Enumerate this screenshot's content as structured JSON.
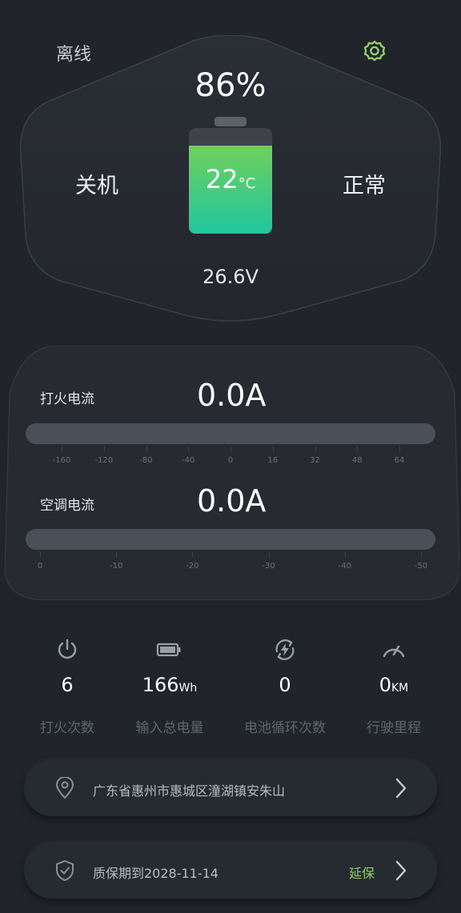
{
  "header": {
    "status": "离线",
    "settings_icon": "gear-icon"
  },
  "battery": {
    "percent": "86%",
    "left_status": "关机",
    "right_status": "正常",
    "temperature": "22",
    "temperature_unit": "°C",
    "voltage": "26.6V",
    "level": 0.86,
    "colors": {
      "fill_top": "#6fd05b",
      "fill_bottom": "#1fc7a0"
    }
  },
  "ignition_current": {
    "label": "打火电流",
    "value": "0.0A",
    "level": 0,
    "ticks": [
      "-160",
      "-120",
      "-80",
      "-40",
      "0",
      "16",
      "32",
      "48",
      "64"
    ]
  },
  "ac_current": {
    "label": "空调电流",
    "value": "0.0A",
    "level": 0,
    "ticks": [
      "0",
      "-10",
      "-20",
      "-30",
      "-40",
      "-50"
    ]
  },
  "stats": [
    {
      "icon": "power-icon",
      "value": "6",
      "unit": "",
      "label": "打火次数"
    },
    {
      "icon": "battery-icon",
      "value": "166",
      "unit": "Wh",
      "label": "输入总电量"
    },
    {
      "icon": "battery-cycle-icon",
      "value": "0",
      "unit": "",
      "label": "电池循环次数"
    },
    {
      "icon": "speedometer-icon",
      "value": "0",
      "unit": "KM",
      "label": "行驶里程"
    }
  ],
  "location": {
    "address": "广东省惠州市惠城区潼湖镇安朱山"
  },
  "warranty": {
    "text": "质保期到2028-11-14",
    "extend_label": "延保",
    "accent": "#8fcf6a"
  }
}
